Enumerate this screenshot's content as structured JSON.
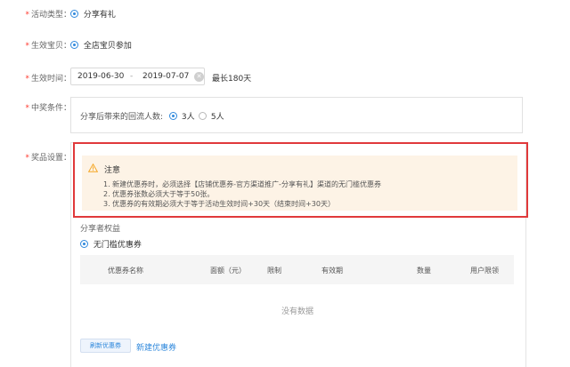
{
  "form": {
    "activity_type": {
      "label": "活动类型：",
      "value": "分享有礼"
    },
    "effective_items": {
      "label": "生效宝贝：",
      "value": "全店宝贝参加"
    },
    "effective_time": {
      "label": "生效时间：",
      "start": "2019-06-30",
      "separator": "-",
      "end": "2019-07-07",
      "hint": "最长180天"
    },
    "win_condition": {
      "label": "中奖条件：",
      "prompt": "分享后带来的回流人数:",
      "options": [
        "3人",
        "5人"
      ],
      "selected": "3人"
    },
    "prize_setting": {
      "label": "奖品设置：",
      "notice": {
        "title": "注意",
        "lines": [
          "1. 新建优惠券时，必须选择【店铺优惠券-官方渠道推广-分享有礼】渠道的无门槛优惠券",
          "2. 优惠券张数必须大于等于50张。",
          "3. 优惠券的有效期必须大于等于活动生效时间+30天（结束时间+30天）"
        ]
      },
      "sharer_rights": "分享者权益",
      "coupon_type": "无门槛优惠券",
      "table_headers": [
        "优惠券名称",
        "面额（元）",
        "限制",
        "有效期",
        "数量",
        "用户限领"
      ],
      "empty_text": "没有数据",
      "refresh_button": "刷新优惠券",
      "new_coupon_link": "新建优惠券"
    },
    "required_mark": "*"
  },
  "colors": {
    "accent": "#3089dc",
    "required": "#ff3b30",
    "highlight_border": "#e0393b",
    "notice_bg": "#fdf3e6",
    "warning": "#f5a623"
  }
}
